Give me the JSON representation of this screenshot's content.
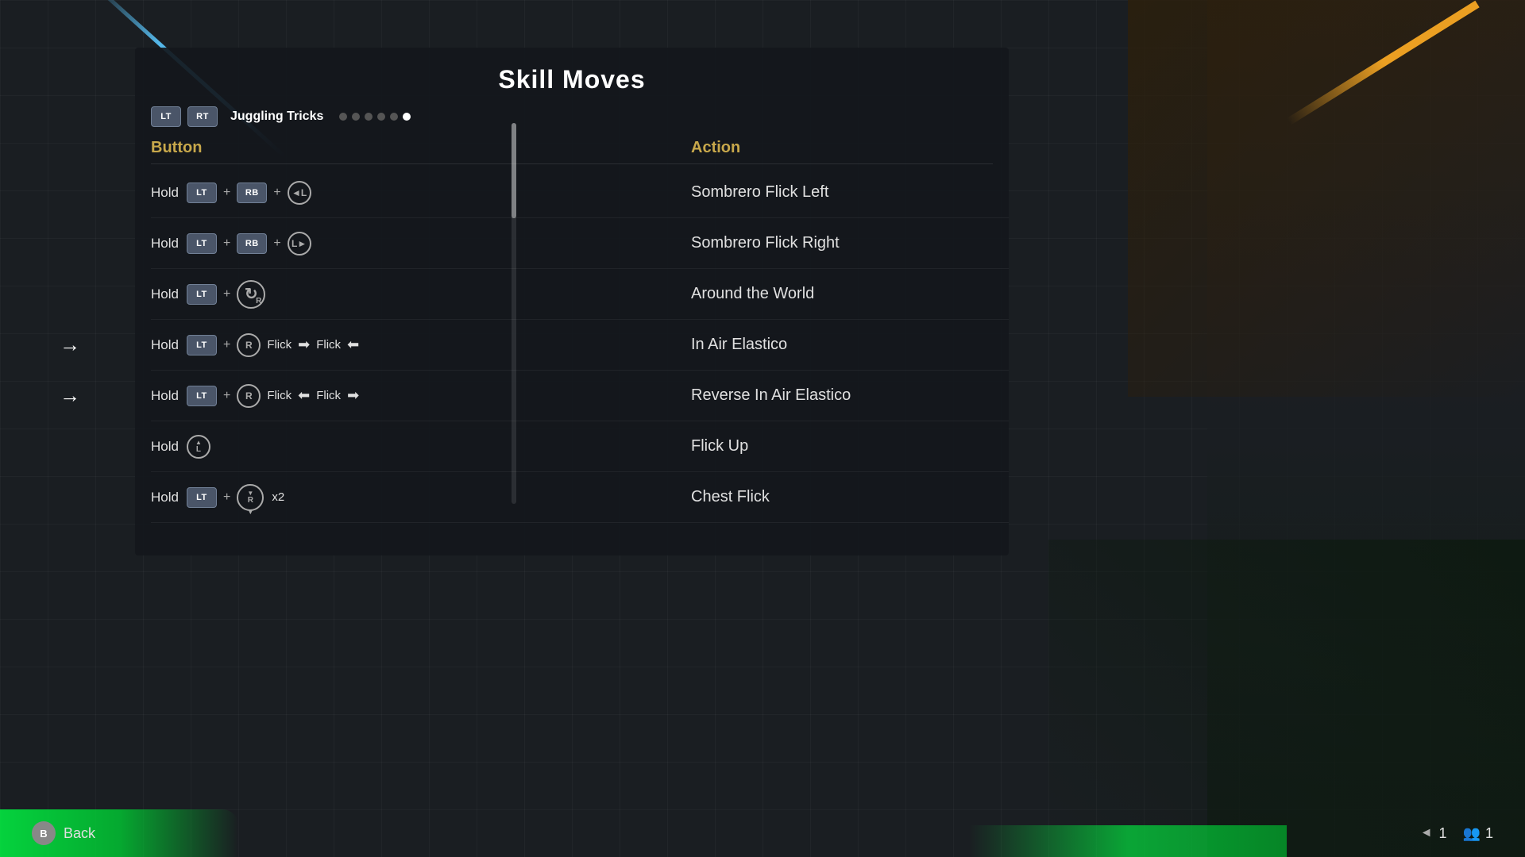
{
  "page": {
    "title": "Skill Moves",
    "tab_label": "Juggling Tricks",
    "tab_lt": "LT",
    "tab_rt": "RT",
    "dots_count": 6,
    "active_dot": 5
  },
  "columns": {
    "button_label": "Button",
    "action_label": "Action"
  },
  "moves": [
    {
      "id": 1,
      "button_text": "Hold LT + RB + ◄L",
      "action": "Sombrero Flick Left",
      "has_left_arrow": false
    },
    {
      "id": 2,
      "button_text": "Hold LT + RB + L►",
      "action": "Sombrero Flick Right",
      "has_left_arrow": false
    },
    {
      "id": 3,
      "button_text": "Hold LT + ↻R",
      "action": "Around the World",
      "has_left_arrow": false
    },
    {
      "id": 4,
      "button_text": "Hold LT + R Flick ➡ Flick ◄",
      "action": "In Air Elastico",
      "has_left_arrow": true
    },
    {
      "id": 5,
      "button_text": "Hold LT + R Flick ◄ Flick ➡",
      "action": "Reverse In Air Elastico",
      "has_left_arrow": true
    },
    {
      "id": 6,
      "button_text": "Hold L↑",
      "action": "Flick Up",
      "has_left_arrow": false
    },
    {
      "id": 7,
      "button_text": "Hold LT + R↓ x2",
      "action": "Chest Flick",
      "has_left_arrow": false
    }
  ],
  "footer": {
    "back_label": "Back",
    "back_button": "B",
    "page_number": "1",
    "player_count": "1"
  }
}
